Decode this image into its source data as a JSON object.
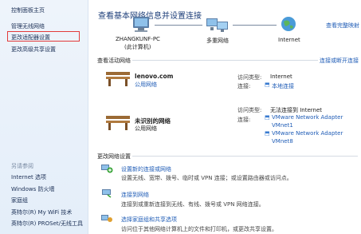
{
  "sidebar": {
    "items": [
      {
        "label": "控制面板主页"
      },
      {
        "label": "管理无线网络"
      },
      {
        "label": "更改适配器设置"
      },
      {
        "label": "更改高级共享设置"
      }
    ],
    "see_also_label": "另请参阅",
    "see_also": [
      {
        "label": "Internet 选项"
      },
      {
        "label": "Windows 防火墙"
      },
      {
        "label": "家庭组"
      },
      {
        "label": "英特尔(R) My WiFi 技术"
      },
      {
        "label": "英特尔(R) PROSet/无线工具"
      }
    ]
  },
  "main": {
    "title": "查看基本网络信息并设置连接",
    "full_map_link": "查看完整映射",
    "map": {
      "computer_name": "ZHANGKUNF-PC",
      "computer_sub": "(此计算机)",
      "network": "多重网络",
      "internet": "Internet"
    },
    "active_header": "查看活动网络",
    "connect_link": "连接或断开连接",
    "networks": [
      {
        "name": "lenovo.com",
        "type": "公用网络",
        "access_label": "访问类型:",
        "access_value": "Internet",
        "conn_label": "连接:",
        "conn_values": [
          "本地连接"
        ]
      },
      {
        "name": "未识别的网络",
        "type": "公用网络",
        "access_label": "访问类型:",
        "access_value": "无法连接到 Internet",
        "conn_label": "连接:",
        "conn_values": [
          "VMware Network Adapter",
          "VMnet1",
          "VMware Network Adapter",
          "VMnet8"
        ]
      }
    ],
    "settings_header": "更改网络设置",
    "tasks": [
      {
        "title": "设置新的连接或网络",
        "desc1": "设置无线、宽带、拨号、临时或 VPN 连接；或设置路由器或访问点。",
        "desc2": ""
      },
      {
        "title": "连接到网络",
        "desc1": "连接到或重新连接到无线、有线、拨号或 VPN 网络连接。",
        "desc2": ""
      },
      {
        "title": "选择家庭组和共享选项",
        "desc1": "访问位于其他网络计算机上的文件和打印机，或更改共享设置。",
        "desc2": ""
      }
    ]
  },
  "colors": {
    "highlight": "#e23b3b",
    "link": "#1f5cb6",
    "title": "#1e3f7a"
  }
}
